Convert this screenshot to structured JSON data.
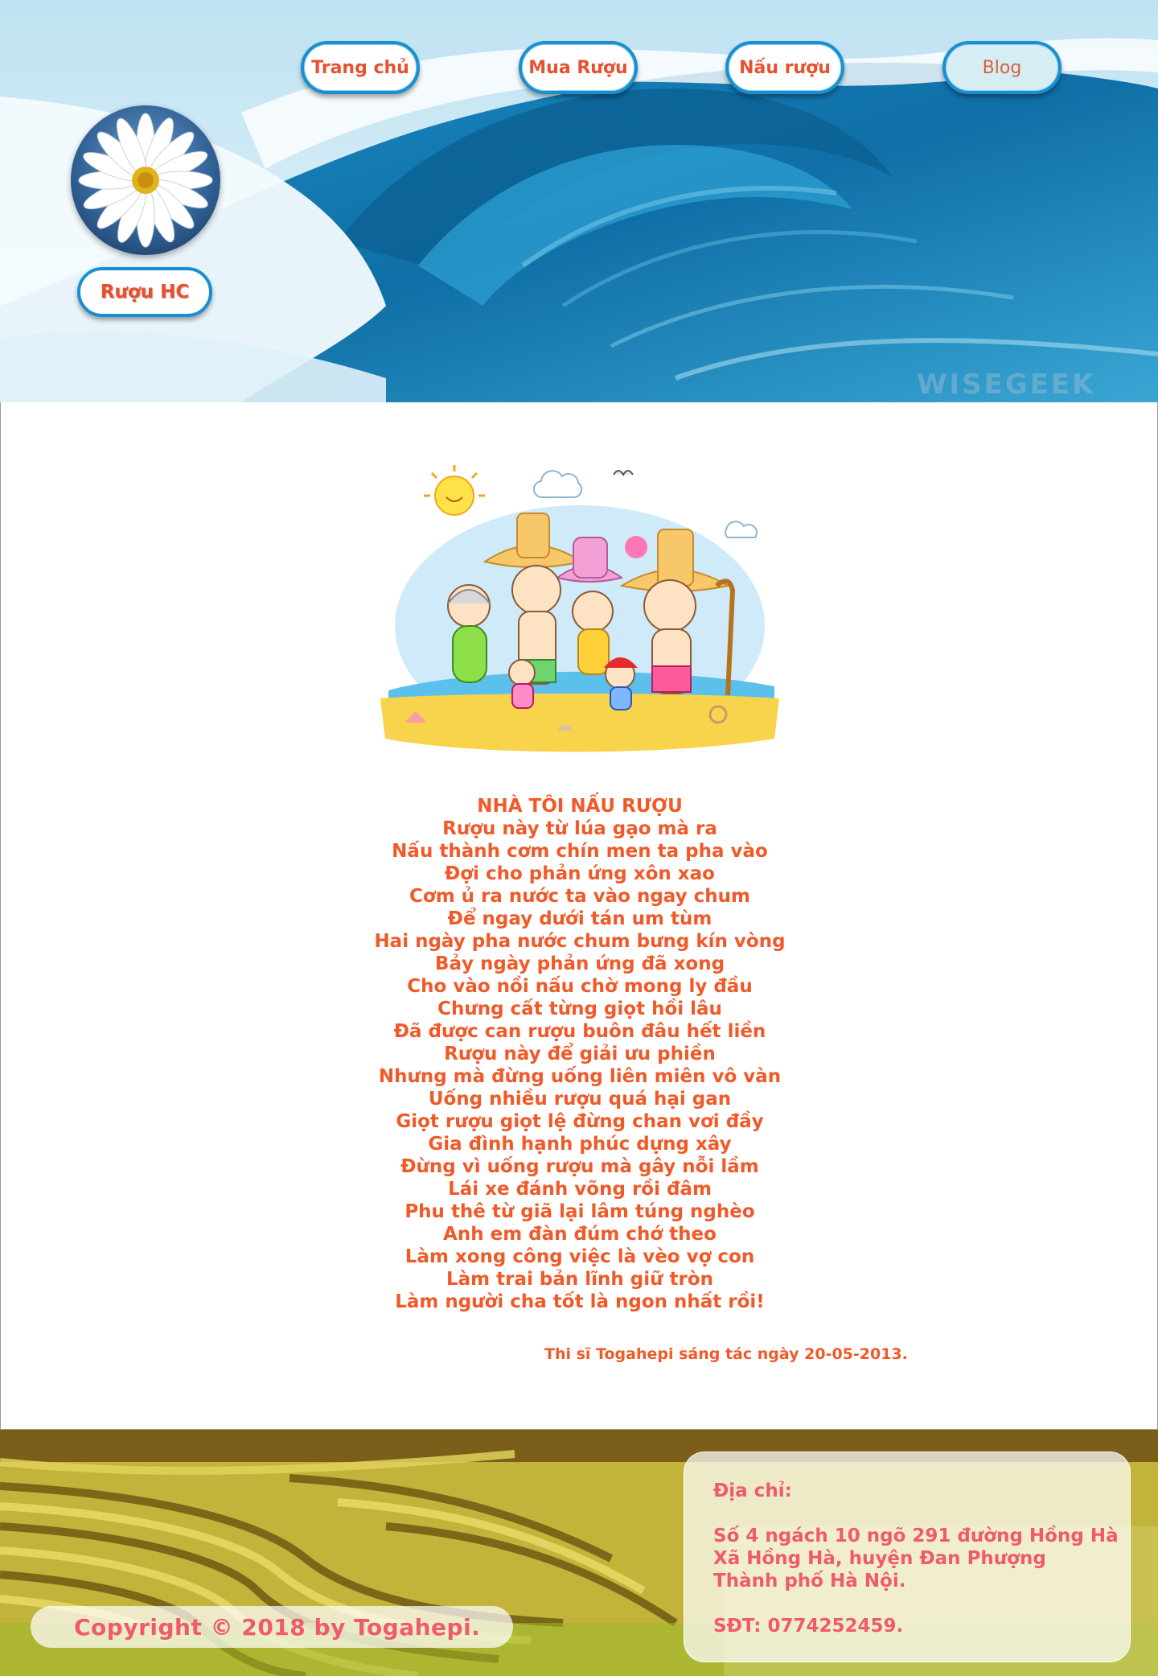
{
  "nav": {
    "items": [
      {
        "label": "Trang chủ"
      },
      {
        "label": "Mua Rượu"
      },
      {
        "label": "Nấu rượu"
      },
      {
        "label": "Blog"
      }
    ]
  },
  "brand": {
    "label": "Rượu HC",
    "logo_icon": "daisy-flower-icon"
  },
  "header": {
    "watermark": "WISEGEEK",
    "background_icon": "ocean-wave-image"
  },
  "main": {
    "illustration_icon": "family-beach-cartoon-image",
    "poem": {
      "title": "NHÀ TÔI NẤU RƯỢU",
      "lines": [
        "Rượu này từ lúa gạo mà ra",
        "Nấu thành cơm chín men ta pha vào",
        "Đợi cho phản ứng xôn xao",
        "Cơm ủ ra nước ta vào ngay chum",
        "Để ngay dưới tán um tùm",
        "Hai ngày pha nước chum bưng kín vòng",
        "Bảy ngày phản ứng đã xong",
        "Cho vào nồi nấu chờ mong ly đầu",
        "Chưng cất từng giọt hồi lâu",
        "Đã được can rượu buôn đâu hết liền",
        "Rượu này để giải ưu phiền",
        "Nhưng mà đừng uống liên miên vô vàn",
        "Uống nhiều rượu quá hại gan",
        "Giọt rượu giọt lệ đừng chan vơi đầy",
        "Gia đình hạnh phúc dựng xây",
        "Đừng vì uống rượu mà gây nỗi lầm",
        "Lái xe đánh võng rồi đâm",
        "Phu thê từ giã lại lâm túng nghèo",
        "Anh em đàn đúm chớ theo",
        "Làm xong công việc là vèo vợ con",
        "Làm trai bản lĩnh giữ tròn",
        "Làm người cha tốt là ngon nhất rồi!"
      ]
    },
    "signature": "Thi sĩ Togahepi sáng tác ngày 20-05-2013."
  },
  "footer": {
    "background_icon": "rice-terrace-image",
    "copyright": "Copyright © 2018 by Togahepi.",
    "address_heading": "Địa chỉ:",
    "address_lines": [
      "Số 4 ngách 10 ngõ 291 đường Hồng Hà",
      "Xã Hồng Hà, huyện Đan Phượng",
      "Thành phố Hà Nội."
    ],
    "phone": "SĐT: 0774252459."
  },
  "colors": {
    "accent_orange": "#f05a28",
    "footer_pink": "#f05a6a",
    "button_border": "#1a8fd0"
  }
}
